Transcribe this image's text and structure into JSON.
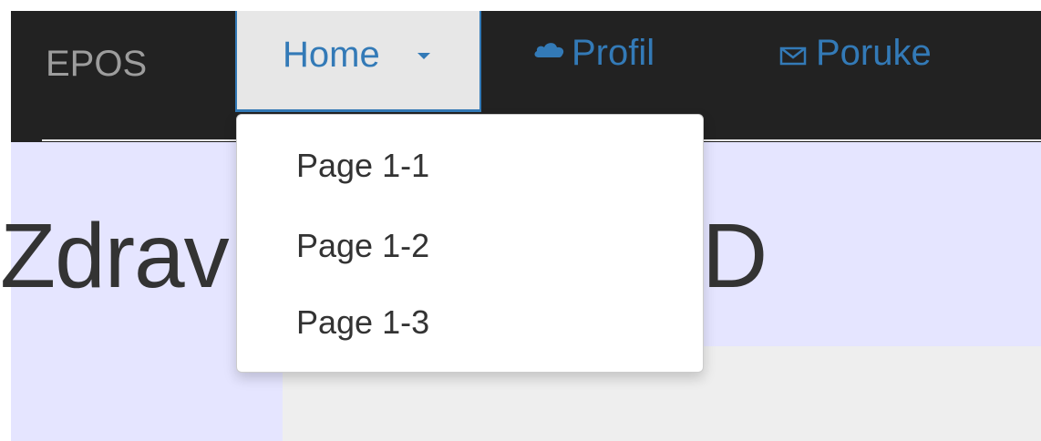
{
  "navbar": {
    "brand": "EPOS",
    "items": [
      {
        "label": "Home",
        "icon": "caret-down-icon",
        "active": true
      },
      {
        "label": "Profil",
        "icon": "cloud-icon"
      },
      {
        "label": "Poruke",
        "icon": "envelope-icon"
      }
    ]
  },
  "dropdown": {
    "items": [
      {
        "label": "Page 1-1"
      },
      {
        "label": "Page 1-2"
      },
      {
        "label": "Page 1-3"
      }
    ]
  },
  "main": {
    "heading_start": "Zdrav",
    "heading_end": "D"
  },
  "colors": {
    "navbar_bg": "#222222",
    "link": "#337ab7",
    "brand": "#9d9d9d",
    "content_bg": "#e5e5ff",
    "active_tab_bg": "#e7e7e7"
  }
}
